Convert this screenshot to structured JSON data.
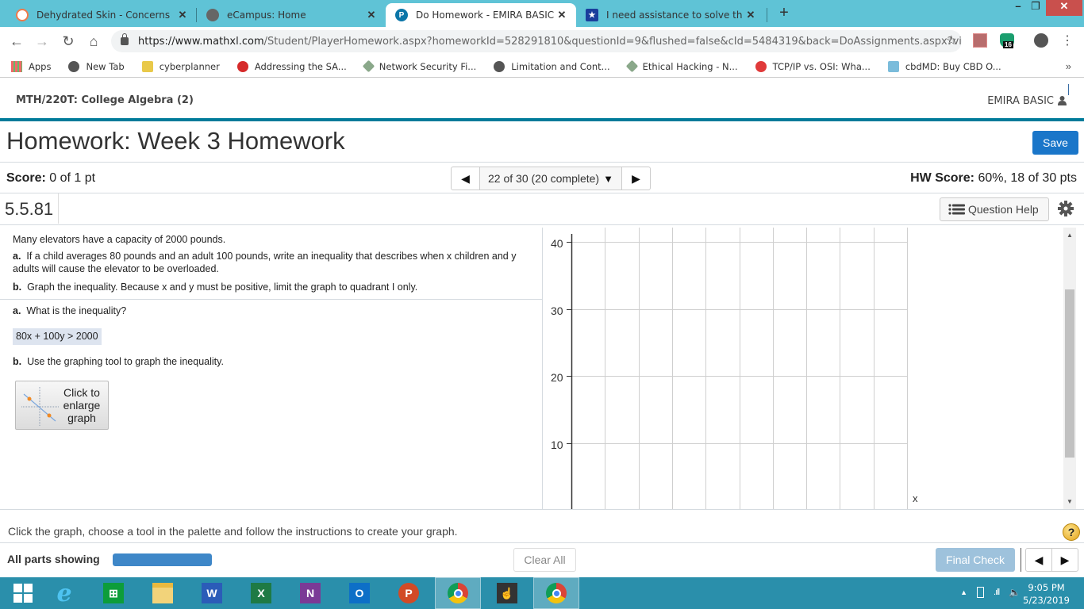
{
  "browser": {
    "tabs": [
      {
        "label": "Dehydrated Skin - Concerns",
        "active": false,
        "icon": "dehydrated-skin-favicon"
      },
      {
        "label": "eCampus: Home",
        "active": false,
        "icon": "globe-icon"
      },
      {
        "label": "Do Homework - EMIRA BASIC",
        "active": true,
        "icon": "pearson-icon"
      },
      {
        "label": "I need assistance to solve the sys",
        "active": false,
        "icon": "star-shield-icon"
      }
    ],
    "new_tab": "+",
    "window_controls": {
      "minimize": "–",
      "restore": "❐",
      "close": "✕"
    },
    "url_host": "https://www.mathxl.com",
    "url_path": "/Student/PlayerHomework.aspx?homeworkId=528291810&questionId=9&flushed=false&cId=5484319&back=DoAssignments.aspx?vie...",
    "extension_badge": "16",
    "bookmarks": [
      {
        "label": "Apps",
        "icon": "apps-grid-icon"
      },
      {
        "label": "New Tab",
        "icon": "globe-icon"
      },
      {
        "label": "cyberplanner",
        "icon": "fcc-icon"
      },
      {
        "label": "Addressing the SA...",
        "icon": "trendmicro-icon"
      },
      {
        "label": "Network Security Fi...",
        "icon": "cert-badge-icon"
      },
      {
        "label": "Limitation and Cont...",
        "icon": "globe-icon"
      },
      {
        "label": "Ethical Hacking - N...",
        "icon": "cert-badge-icon"
      },
      {
        "label": "TCP/IP vs. OSI: Wha...",
        "icon": "red-s-icon"
      },
      {
        "label": "cbdMD: Buy CBD O...",
        "icon": "cbdmd-icon"
      }
    ],
    "bookmarks_overflow": "»"
  },
  "course": {
    "title": "MTH/220T: College Algebra (2)",
    "user": "EMIRA BASIC"
  },
  "homework": {
    "title": "Homework: Week 3 Homework",
    "save_label": "Save",
    "score_label": "Score:",
    "score_value": "0 of 1 pt",
    "question_nav": "22 of 30 (20 complete)",
    "hw_score_label": "HW Score:",
    "hw_score_value": "60%, 18 of 30 pts",
    "question_id": "5.5.81",
    "question_help": "Question Help"
  },
  "question": {
    "intro": "Many elevators have a capacity of 2000 pounds.",
    "part_a_label": "a.",
    "part_a_text": "If a child averages 80 pounds and an adult 100 pounds, write an inequality that describes when x children and y adults will cause the elevator to be overloaded.",
    "part_b_label": "b.",
    "part_b_text": "Graph the inequality.  Because x and y must be positive, limit the graph to quadrant I only.",
    "ask_a_label": "a.",
    "ask_a_text": "What is the inequality?",
    "answer": "80x + 100y  > 2000",
    "ask_b_label": "b.",
    "ask_b_text": "Use the graphing tool to graph the inequality.",
    "enlarge_label": "Click to enlarge graph"
  },
  "graph": {
    "y_ticks": [
      "40",
      "30",
      "20",
      "10"
    ],
    "x_axis_label": "x",
    "y_range_visible": [
      0,
      42
    ]
  },
  "footer": {
    "instruction": "Click the graph, choose a tool in the palette and follow the instructions to create your graph.",
    "parts_label": "All parts showing",
    "parts_progress": 1.0,
    "clear_all": "Clear All",
    "final_check": "Final Check"
  },
  "taskbar": {
    "apps": [
      "windows-start",
      "internet-explorer",
      "microsoft-store",
      "file-explorer",
      "word",
      "excel",
      "onenote",
      "outlook",
      "powerpoint",
      "chrome",
      "touch-keyboard",
      "chrome"
    ],
    "time": "9:05 PM",
    "date": "5/23/2019"
  },
  "colors": {
    "tabstrip": "#5fc3d6",
    "brand_teal": "#007b9a",
    "save_blue": "#1a76c9",
    "progress_blue": "#3e87c8",
    "taskbar": "#2a8fab"
  }
}
